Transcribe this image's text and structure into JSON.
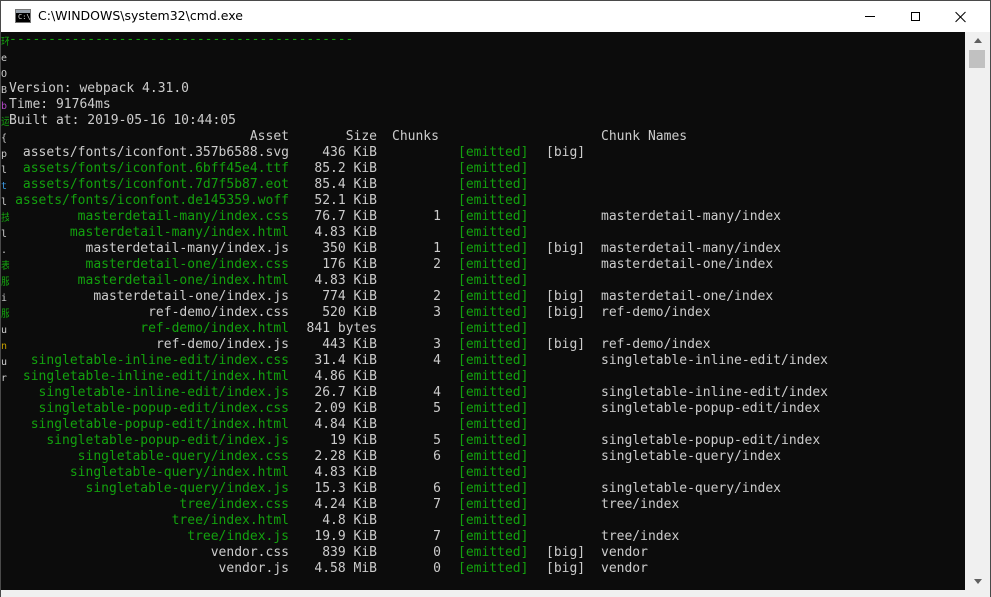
{
  "window": {
    "title": "C:\\WINDOWS\\system32\\cmd.exe",
    "icon_text": "C:\\",
    "controls": [
      "minimize-icon",
      "maximize-icon",
      "close-icon"
    ]
  },
  "colors": {
    "console_bg": "#0c0c0c",
    "text": "#cccccc",
    "green": "#13a10e",
    "yellow": "#c19c00",
    "magenta": "#b148c6"
  },
  "console": {
    "separator": "--------------------------------------------",
    "version_line": "Version: webpack 4.31.0",
    "time_line": "Time: 91764ms",
    "built_line": "Built at: 2019-05-16 10:44:05",
    "headers": {
      "asset": "Asset",
      "size": "Size",
      "chunks": "Chunks",
      "chunk_names": "Chunk Names"
    },
    "rows": [
      {
        "asset": "assets/fonts/iconfont.357b6588.svg",
        "asset_color": "white",
        "size": "436 KiB",
        "chunks": "",
        "emitted": "[emitted]",
        "big": "[big]",
        "chunk_names": ""
      },
      {
        "asset": "assets/fonts/iconfont.6bff45e4.ttf",
        "asset_color": "green",
        "size": "85.2 KiB",
        "chunks": "",
        "emitted": "[emitted]",
        "big": "",
        "chunk_names": ""
      },
      {
        "asset": "assets/fonts/iconfont.7d7f5b87.eot",
        "asset_color": "green",
        "size": "85.4 KiB",
        "chunks": "",
        "emitted": "[emitted]",
        "big": "",
        "chunk_names": ""
      },
      {
        "asset": "assets/fonts/iconfont.de145359.woff",
        "asset_color": "green",
        "size": "52.1 KiB",
        "chunks": "",
        "emitted": "[emitted]",
        "big": "",
        "chunk_names": ""
      },
      {
        "asset": "masterdetail-many/index.css",
        "asset_color": "green",
        "size": "76.7 KiB",
        "chunks": "1",
        "emitted": "[emitted]",
        "big": "",
        "chunk_names": "masterdetail-many/index"
      },
      {
        "asset": "masterdetail-many/index.html",
        "asset_color": "green",
        "size": "4.83 KiB",
        "chunks": "",
        "emitted": "[emitted]",
        "big": "",
        "chunk_names": ""
      },
      {
        "asset": "masterdetail-many/index.js",
        "asset_color": "white",
        "size": "350 KiB",
        "chunks": "1",
        "emitted": "[emitted]",
        "big": "[big]",
        "chunk_names": "masterdetail-many/index"
      },
      {
        "asset": "masterdetail-one/index.css",
        "asset_color": "green",
        "size": "176 KiB",
        "chunks": "2",
        "emitted": "[emitted]",
        "big": "",
        "chunk_names": "masterdetail-one/index"
      },
      {
        "asset": "masterdetail-one/index.html",
        "asset_color": "green",
        "size": "4.83 KiB",
        "chunks": "",
        "emitted": "[emitted]",
        "big": "",
        "chunk_names": ""
      },
      {
        "asset": "masterdetail-one/index.js",
        "asset_color": "white",
        "size": "774 KiB",
        "chunks": "2",
        "emitted": "[emitted]",
        "big": "[big]",
        "chunk_names": "masterdetail-one/index"
      },
      {
        "asset": "ref-demo/index.css",
        "asset_color": "white",
        "size": "520 KiB",
        "chunks": "3",
        "emitted": "[emitted]",
        "big": "[big]",
        "chunk_names": "ref-demo/index"
      },
      {
        "asset": "ref-demo/index.html",
        "asset_color": "green",
        "size": "841 bytes",
        "chunks": "",
        "emitted": "[emitted]",
        "big": "",
        "chunk_names": ""
      },
      {
        "asset": "ref-demo/index.js",
        "asset_color": "white",
        "size": "443 KiB",
        "chunks": "3",
        "emitted": "[emitted]",
        "big": "[big]",
        "chunk_names": "ref-demo/index"
      },
      {
        "asset": "singletable-inline-edit/index.css",
        "asset_color": "green",
        "size": "31.4 KiB",
        "chunks": "4",
        "emitted": "[emitted]",
        "big": "",
        "chunk_names": "singletable-inline-edit/index"
      },
      {
        "asset": "singletable-inline-edit/index.html",
        "asset_color": "green",
        "size": "4.86 KiB",
        "chunks": "",
        "emitted": "[emitted]",
        "big": "",
        "chunk_names": ""
      },
      {
        "asset": "singletable-inline-edit/index.js",
        "asset_color": "green",
        "size": "26.7 KiB",
        "chunks": "4",
        "emitted": "[emitted]",
        "big": "",
        "chunk_names": "singletable-inline-edit/index"
      },
      {
        "asset": "singletable-popup-edit/index.css",
        "asset_color": "green",
        "size": "2.09 KiB",
        "chunks": "5",
        "emitted": "[emitted]",
        "big": "",
        "chunk_names": "singletable-popup-edit/index"
      },
      {
        "asset": "singletable-popup-edit/index.html",
        "asset_color": "green",
        "size": "4.84 KiB",
        "chunks": "",
        "emitted": "[emitted]",
        "big": "",
        "chunk_names": ""
      },
      {
        "asset": "singletable-popup-edit/index.js",
        "asset_color": "green",
        "size": "19 KiB",
        "chunks": "5",
        "emitted": "[emitted]",
        "big": "",
        "chunk_names": "singletable-popup-edit/index"
      },
      {
        "asset": "singletable-query/index.css",
        "asset_color": "green",
        "size": "2.28 KiB",
        "chunks": "6",
        "emitted": "[emitted]",
        "big": "",
        "chunk_names": "singletable-query/index"
      },
      {
        "asset": "singletable-query/index.html",
        "asset_color": "green",
        "size": "4.83 KiB",
        "chunks": "",
        "emitted": "[emitted]",
        "big": "",
        "chunk_names": ""
      },
      {
        "asset": "singletable-query/index.js",
        "asset_color": "green",
        "size": "15.3 KiB",
        "chunks": "6",
        "emitted": "[emitted]",
        "big": "",
        "chunk_names": "singletable-query/index"
      },
      {
        "asset": "tree/index.css",
        "asset_color": "green",
        "size": "4.24 KiB",
        "chunks": "7",
        "emitted": "[emitted]",
        "big": "",
        "chunk_names": "tree/index"
      },
      {
        "asset": "tree/index.html",
        "asset_color": "green",
        "size": "4.8 KiB",
        "chunks": "",
        "emitted": "[emitted]",
        "big": "",
        "chunk_names": ""
      },
      {
        "asset": "tree/index.js",
        "asset_color": "green",
        "size": "19.9 KiB",
        "chunks": "7",
        "emitted": "[emitted]",
        "big": "",
        "chunk_names": "tree/index"
      },
      {
        "asset": "vendor.css",
        "asset_color": "white",
        "size": "839 KiB",
        "chunks": "0",
        "emitted": "[emitted]",
        "big": "[big]",
        "chunk_names": "vendor"
      },
      {
        "asset": "vendor.js",
        "asset_color": "white",
        "size": "4.58 MiB",
        "chunks": "0",
        "emitted": "[emitted]",
        "big": "[big]",
        "chunk_names": "vendor"
      }
    ]
  },
  "left_strip": [
    {
      "char": "环",
      "color": "#13a10e"
    },
    {
      "char": "e",
      "color": "#cccccc"
    },
    {
      "char": "O",
      "color": "#cccccc"
    },
    {
      "char": "B",
      "color": "#cccccc"
    },
    {
      "char": "b",
      "color": "#b148c6"
    },
    {
      "char": "运",
      "color": "#13a10e"
    },
    {
      "char": "{",
      "color": "#cccccc"
    },
    {
      "char": "p",
      "color": "#cccccc"
    },
    {
      "char": "l",
      "color": "#cccccc"
    },
    {
      "char": "t",
      "color": "#3a96dd"
    },
    {
      "char": "l",
      "color": "#cccccc"
    },
    {
      "char": "技",
      "color": "#13a10e"
    },
    {
      "char": "l",
      "color": "#cccccc"
    },
    {
      "char": ".",
      "color": "#cccccc"
    },
    {
      "char": "表",
      "color": "#13a10e"
    },
    {
      "char": "服",
      "color": "#13a10e"
    },
    {
      "char": "i",
      "color": "#cccccc"
    },
    {
      "char": "服",
      "color": "#13a10e"
    },
    {
      "char": "u",
      "color": "#cccccc"
    },
    {
      "char": "n",
      "color": "#c19c00"
    },
    {
      "char": "u",
      "color": "#cccccc"
    },
    {
      "char": "r",
      "color": "#cccccc"
    }
  ]
}
